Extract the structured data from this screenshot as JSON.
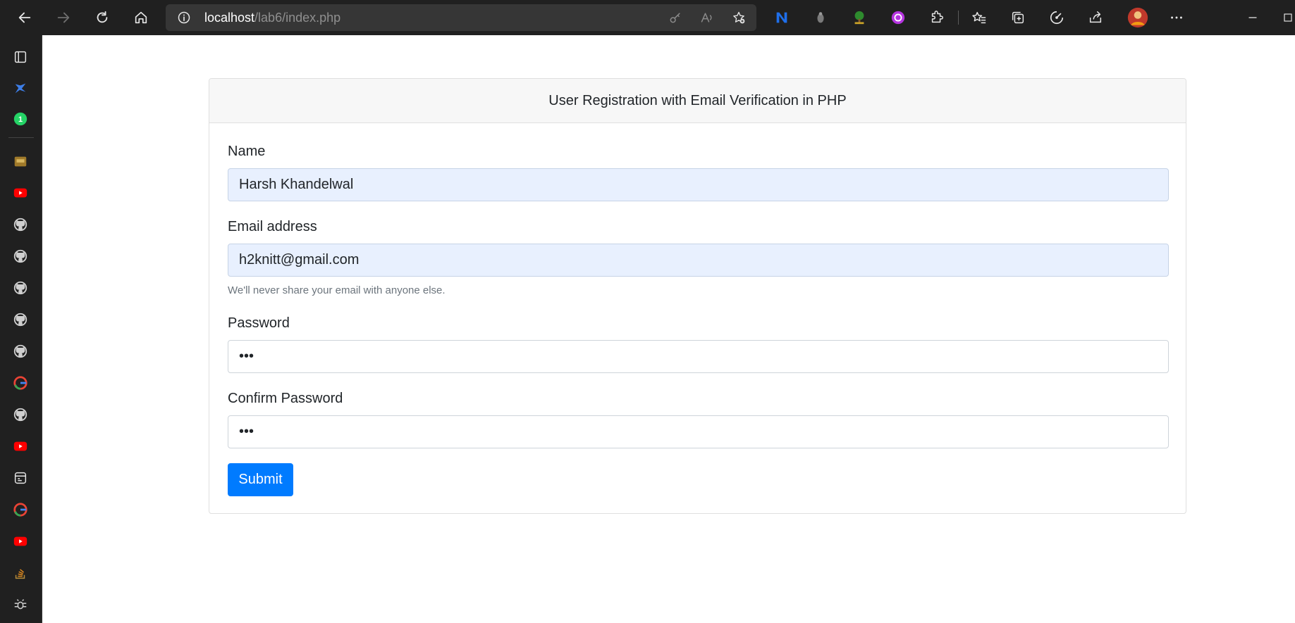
{
  "browser": {
    "url_host": "localhost",
    "url_path": "/lab6/index.php",
    "toolbar_icons": [
      "back-icon",
      "forward-icon",
      "refresh-icon",
      "home-icon",
      "info-icon",
      "key-icon",
      "read-aloud-icon",
      "add-favorite-icon",
      "extension-n-icon",
      "extension-gray-icon",
      "extension-tree-icon",
      "extension-purple-icon",
      "extensions-puzzle-icon",
      "favorites-icon",
      "collections-icon",
      "performance-icon",
      "share-icon",
      "profile-avatar",
      "more-icon"
    ]
  },
  "sidebar": {
    "items": [
      "tab-actions-icon",
      "bing-icon",
      "whatsapp-icon",
      "folder-icon",
      "youtube-icon",
      "github-icon",
      "github-icon",
      "github-icon",
      "github-icon",
      "github-icon",
      "google-icon",
      "github-icon",
      "youtube-icon",
      "app-icon",
      "google-icon",
      "youtube-icon",
      "stack-icon",
      "bug-icon"
    ],
    "whatsapp_badge": "1"
  },
  "form": {
    "title": "User Registration with Email Verification in PHP",
    "name_label": "Name",
    "name_value": "Harsh Khandelwal",
    "email_label": "Email address",
    "email_value": "h2knitt@gmail.com",
    "email_hint": "We'll never share your email with anyone else.",
    "password_label": "Password",
    "password_value": "•••",
    "confirm_label": "Confirm Password",
    "confirm_value": "•••",
    "submit_label": "Submit"
  },
  "colors": {
    "primary": "#007bff",
    "autofill": "#e8f0fe",
    "chrome_dark": "#202020"
  }
}
